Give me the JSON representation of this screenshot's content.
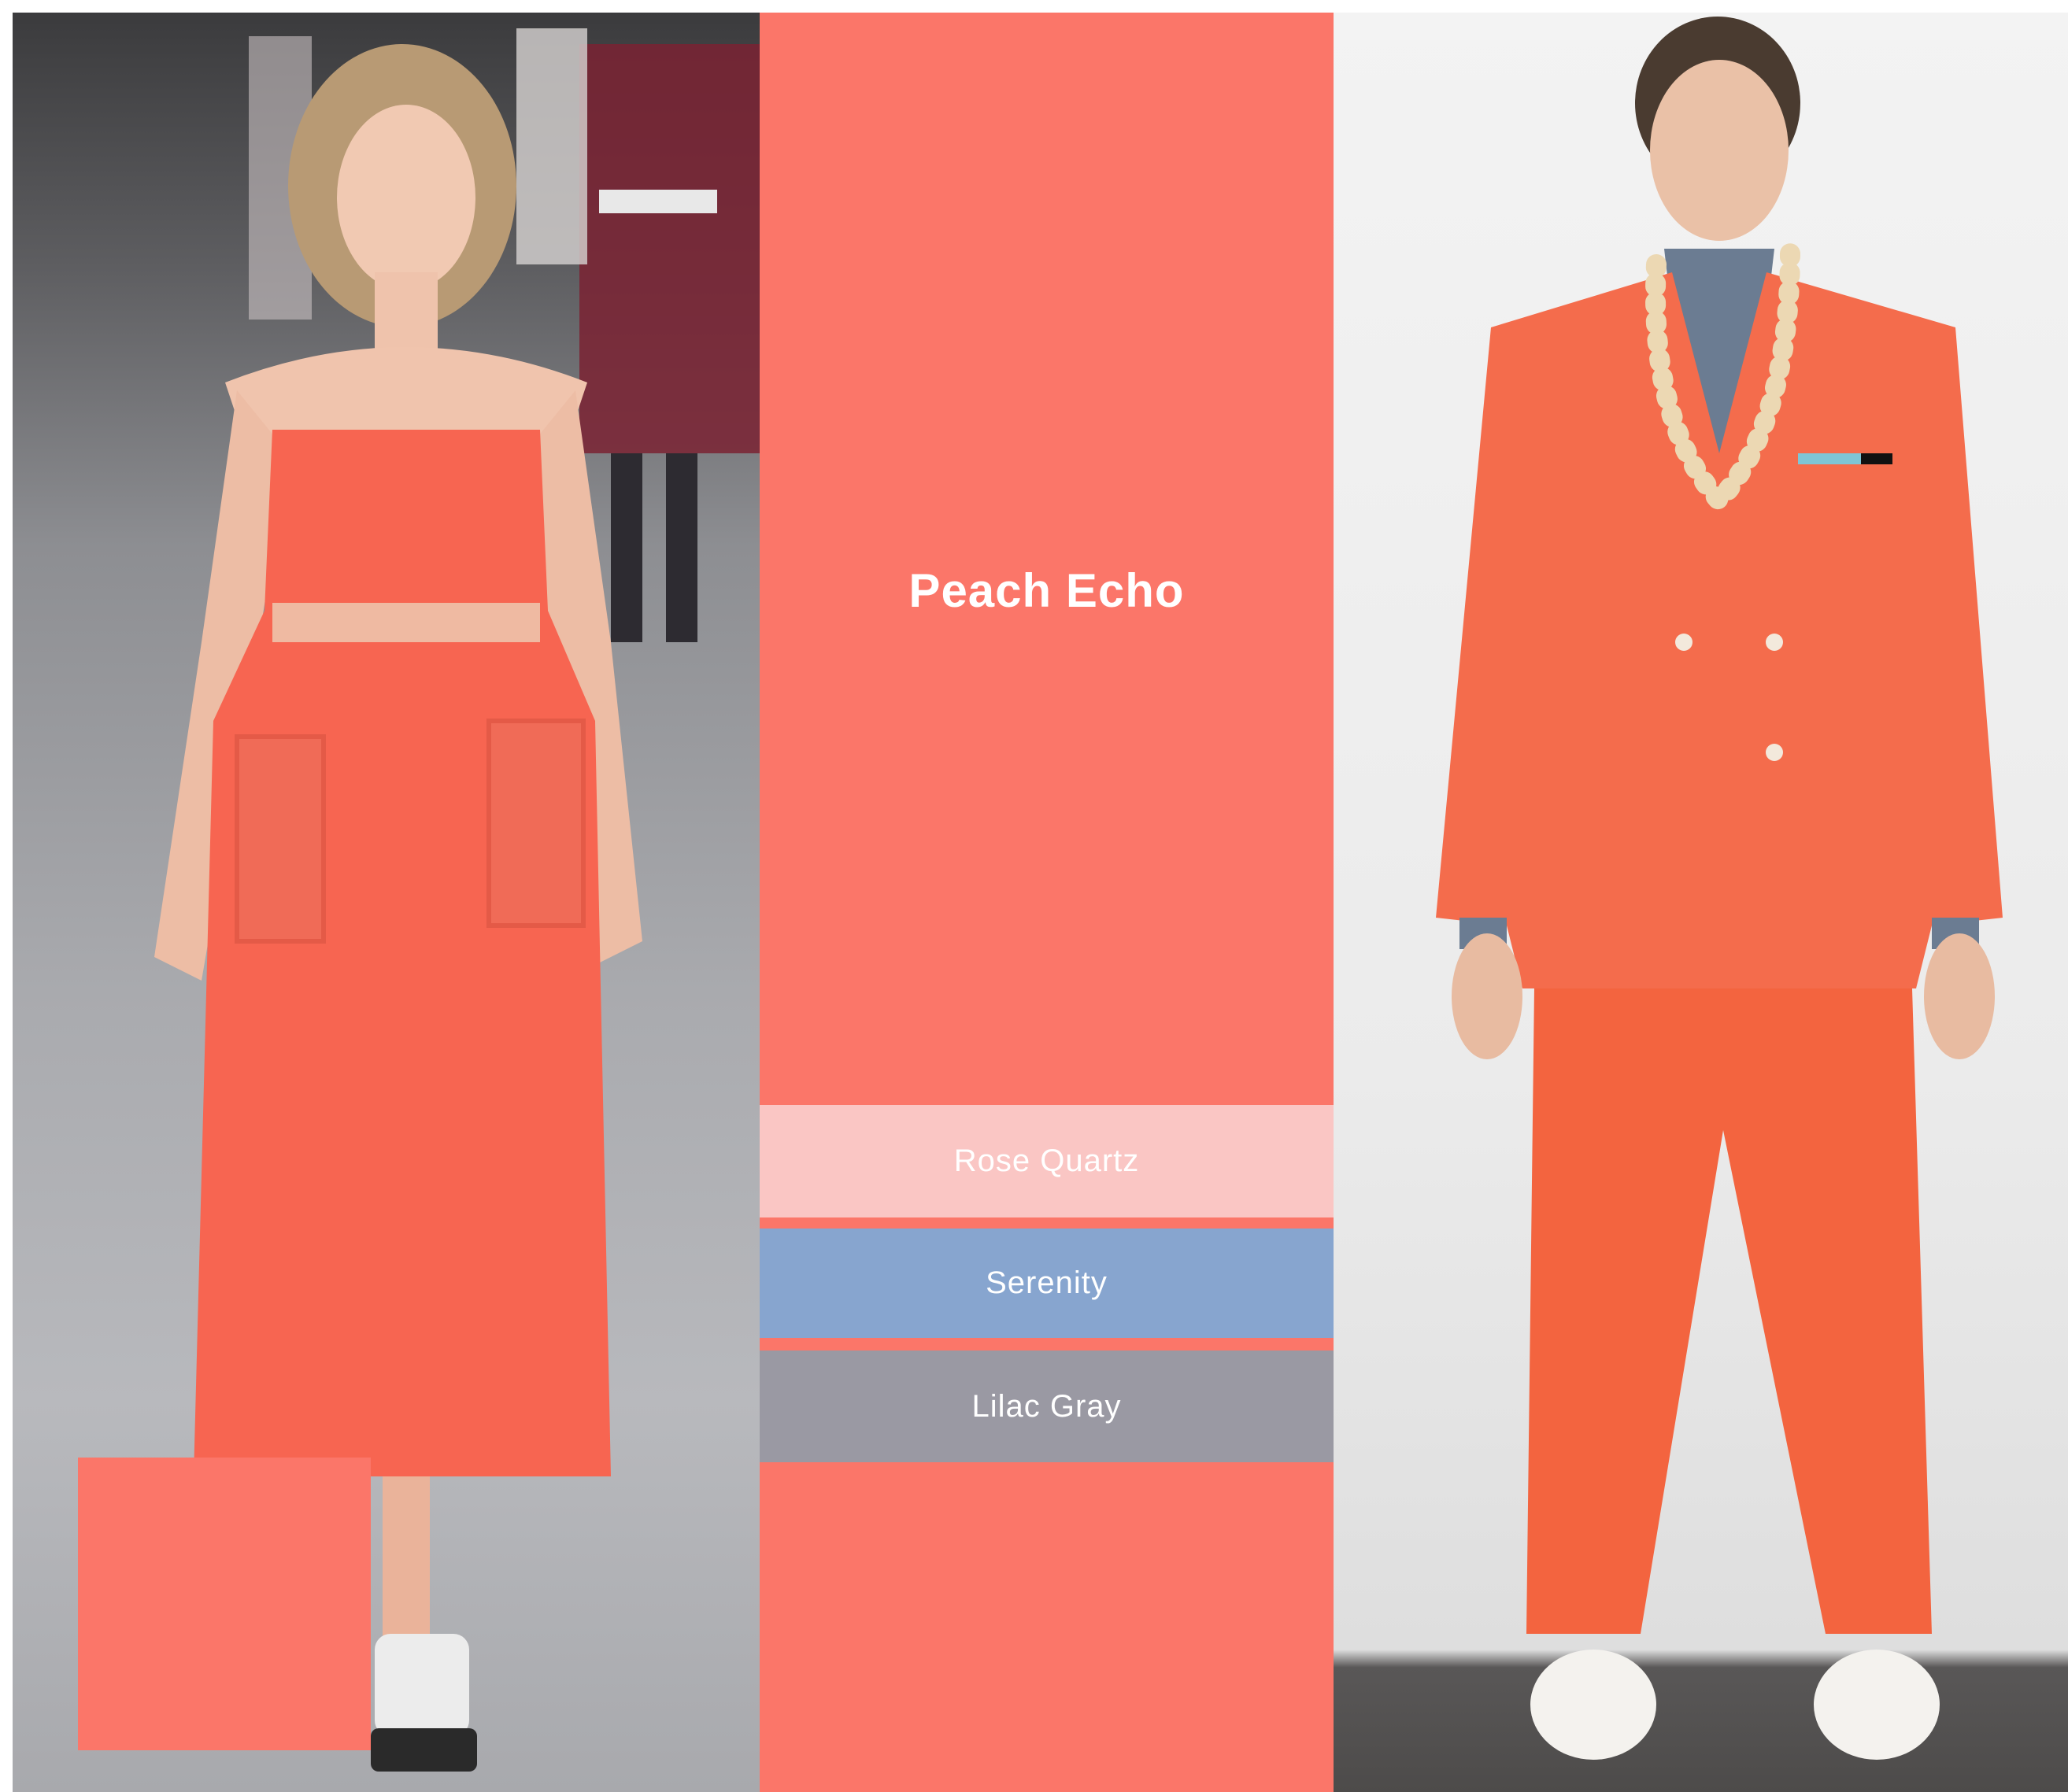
{
  "palette": {
    "title": "Peach Echo",
    "bands": [
      {
        "label": "Rose Quartz",
        "color": "#fac6c4"
      },
      {
        "label": "Serenity",
        "color": "#87a5cf"
      },
      {
        "label": "Lilac Gray",
        "color": "#9a99a3"
      }
    ],
    "colors": {
      "peach_echo": "#fb7669",
      "rose_quartz": "#fac6c4",
      "serenity": "#87a5cf",
      "lilac_gray": "#9a99a3"
    }
  }
}
